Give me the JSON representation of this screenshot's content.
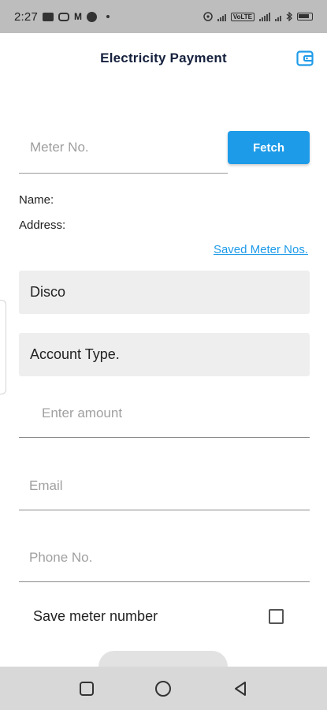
{
  "status_bar": {
    "time": "2:27",
    "battery_level": 0.6
  },
  "header": {
    "title": "Electricity Payment",
    "wallet_icon": "wallet-icon"
  },
  "meter": {
    "placeholder": "Meter No.",
    "value": "",
    "fetch_label": "Fetch"
  },
  "customer": {
    "name_label": "Name:",
    "address_label": "Address:"
  },
  "saved_link": "Saved Meter Nos.",
  "disco": {
    "label": "Disco"
  },
  "account_type": {
    "label": "Account Type."
  },
  "amount": {
    "placeholder": "Enter amount"
  },
  "email": {
    "placeholder": "Email"
  },
  "phone": {
    "placeholder": "Phone No."
  },
  "save_meter": {
    "label": "Save meter number",
    "checked": false
  },
  "nav": {
    "recents_icon": "square-icon",
    "home_icon": "circle-icon",
    "back_icon": "triangle-back-icon"
  },
  "colors": {
    "accent": "#1e9be8",
    "title": "#16213e",
    "field_bg": "#eeeeee",
    "status_bar": "#bdbdbd",
    "nav_bar": "#d8d8d8"
  }
}
